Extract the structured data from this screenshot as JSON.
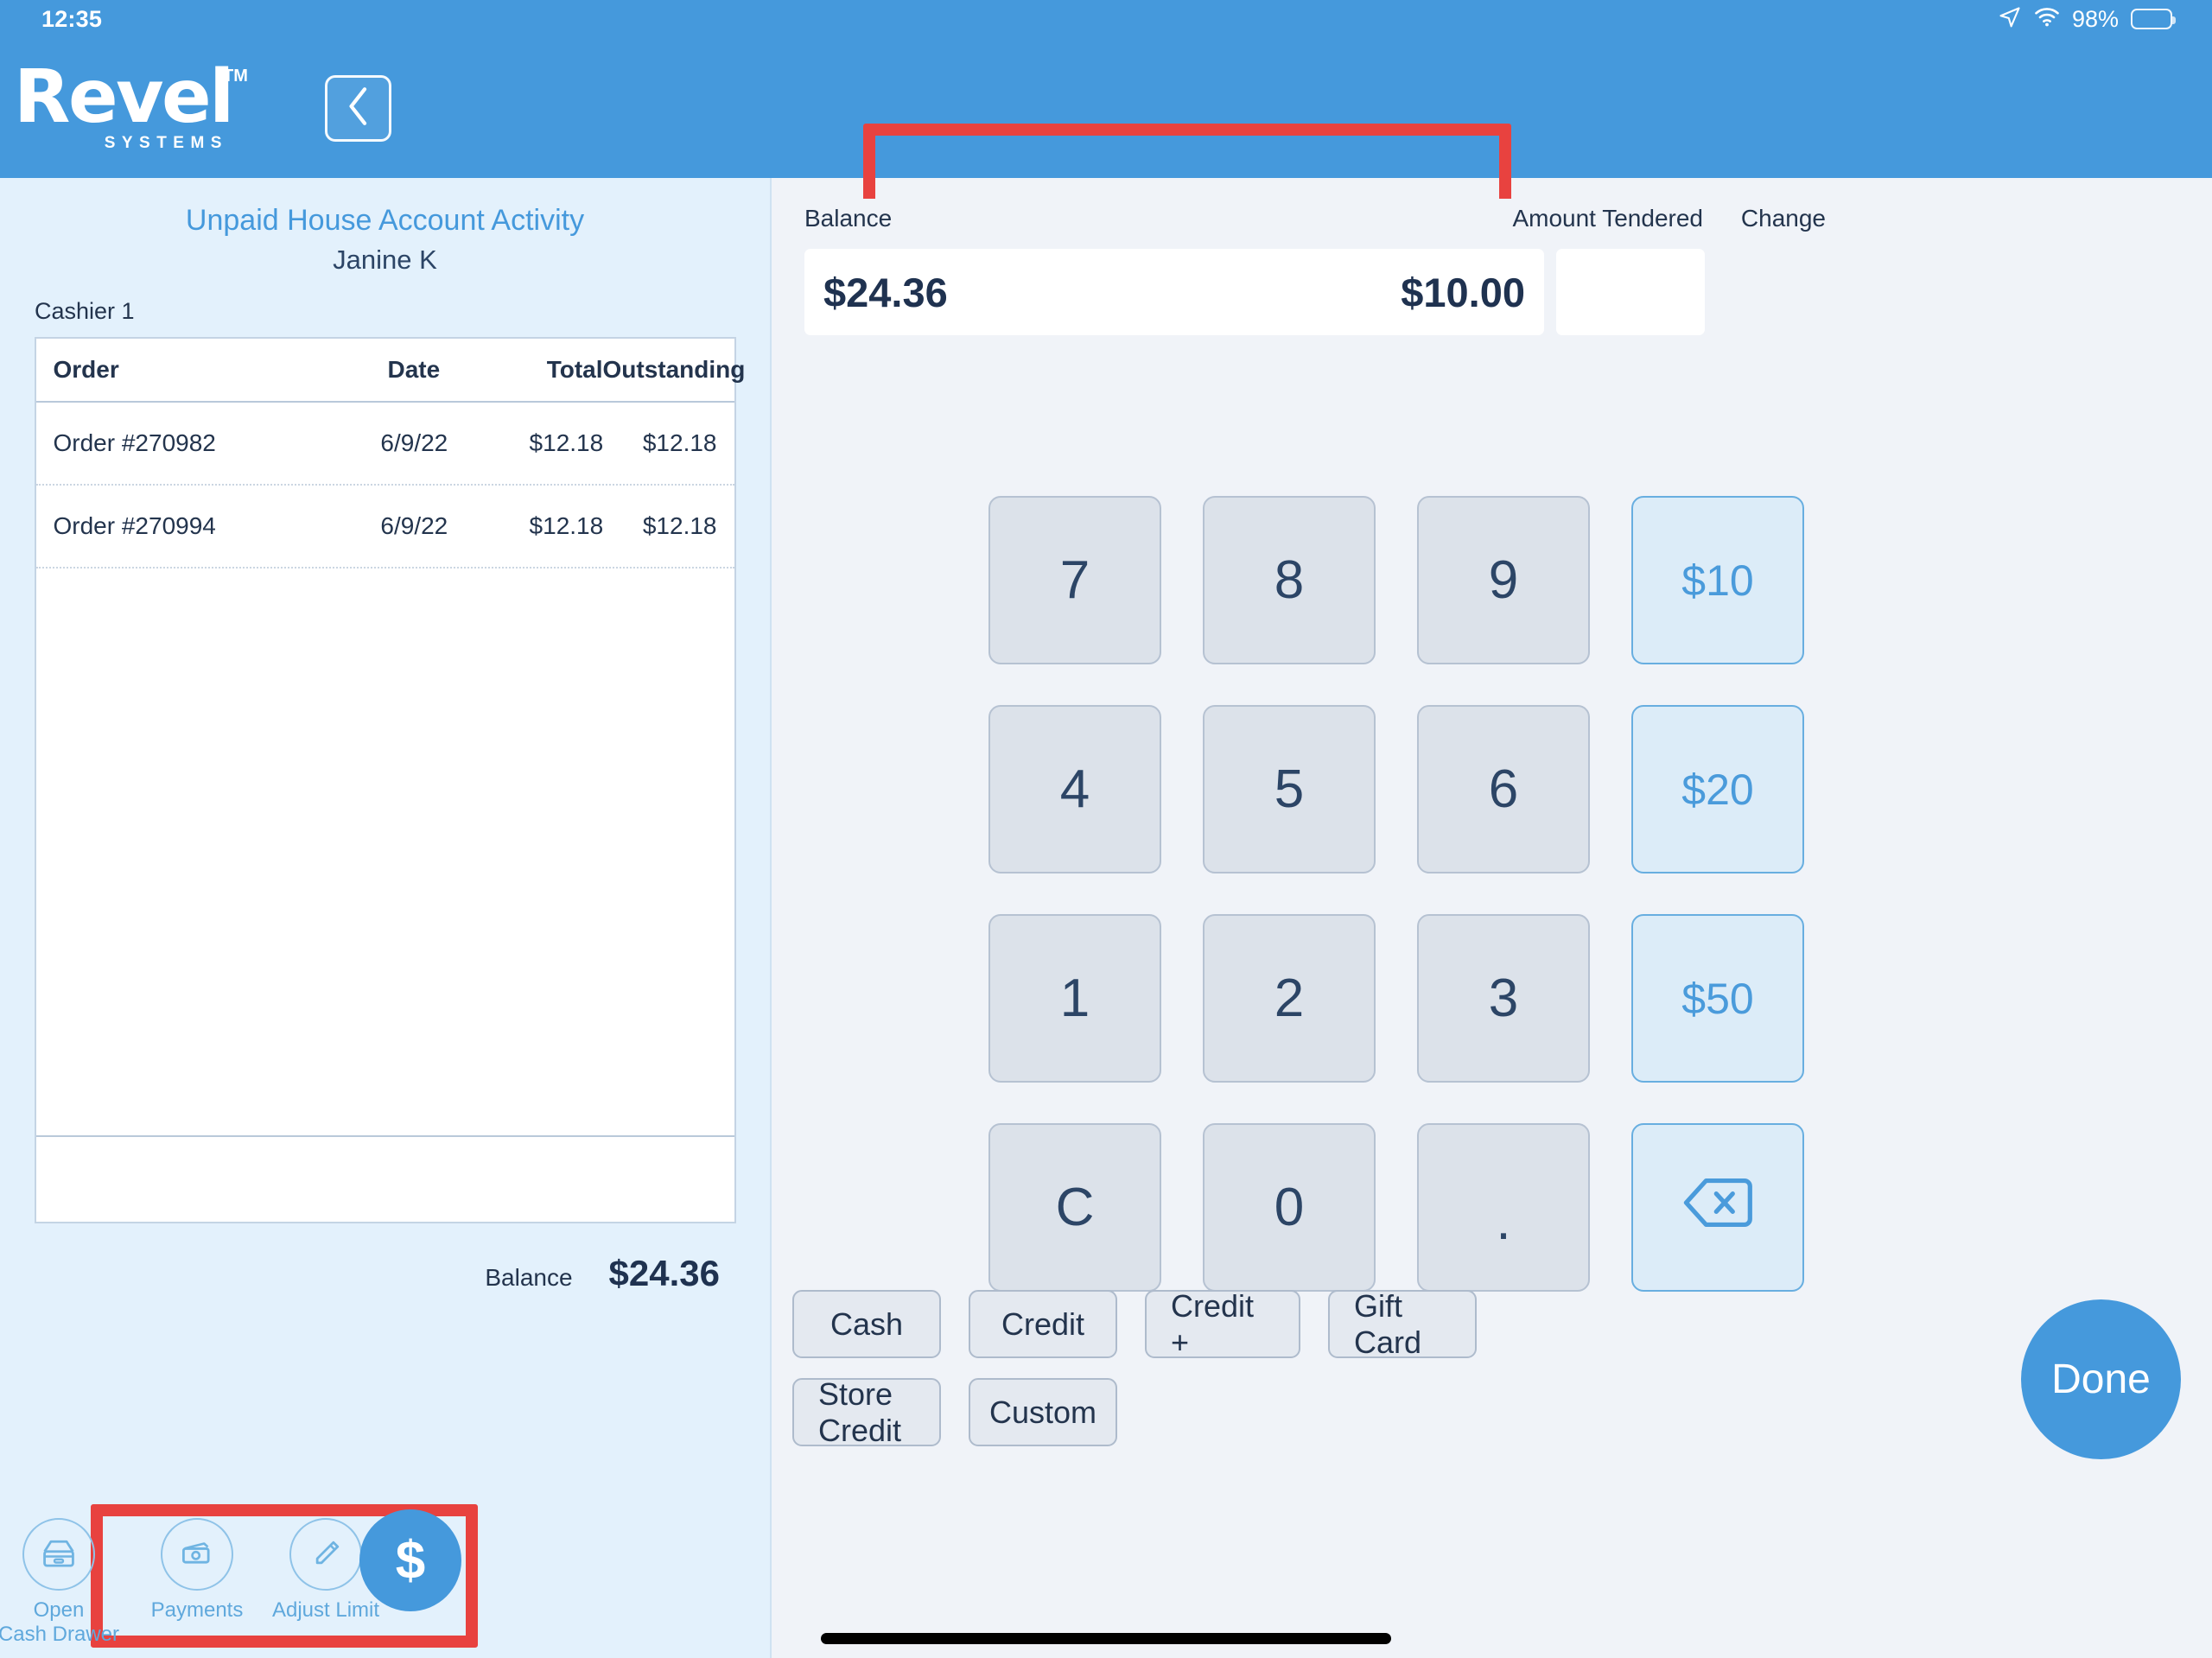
{
  "status_bar": {
    "time": "12:35",
    "battery_percent": "98%",
    "icons": [
      "location-arrow-icon",
      "wifi-icon",
      "battery-icon"
    ]
  },
  "header": {
    "logo_word": "Revel",
    "logo_tm": "TM",
    "logo_subtitle": "SYSTEMS",
    "back_label": "Back"
  },
  "left_panel": {
    "title": "Unpaid House Account Activity",
    "subtitle": "Janine K",
    "cashier": "Cashier 1",
    "table": {
      "columns": [
        "Order",
        "Date",
        "Total",
        "Outstanding"
      ],
      "rows": [
        {
          "order": "Order #270982",
          "date": "6/9/22",
          "total": "$12.18",
          "outstanding": "$12.18"
        },
        {
          "order": "Order #270994",
          "date": "6/9/22",
          "total": "$12.18",
          "outstanding": "$12.18"
        }
      ]
    },
    "balance_label": "Balance",
    "balance_value": "$24.36"
  },
  "toolbar": {
    "open_cash_drawer_line1": "Open",
    "open_cash_drawer_line2": "Cash Drawer",
    "payments_label": "Payments",
    "adjust_limit_label": "Adjust Limit",
    "dollar_fab_label": "$"
  },
  "tender": {
    "balance_label": "Balance",
    "amount_tendered_label": "Amount Tendered",
    "change_label": "Change",
    "balance_value": "$24.36",
    "amount_tendered_value": "$10.00",
    "change_value": ""
  },
  "keypad": {
    "keys": [
      {
        "label": "7",
        "type": "num"
      },
      {
        "label": "8",
        "type": "num"
      },
      {
        "label": "9",
        "type": "num"
      },
      {
        "label": "$10",
        "type": "cash"
      },
      {
        "label": "4",
        "type": "num"
      },
      {
        "label": "5",
        "type": "num"
      },
      {
        "label": "6",
        "type": "num"
      },
      {
        "label": "$20",
        "type": "cash"
      },
      {
        "label": "1",
        "type": "num"
      },
      {
        "label": "2",
        "type": "num"
      },
      {
        "label": "3",
        "type": "num"
      },
      {
        "label": "$50",
        "type": "cash"
      },
      {
        "label": "C",
        "type": "num"
      },
      {
        "label": "0",
        "type": "num"
      },
      {
        "label": ".",
        "type": "dot"
      },
      {
        "label": "",
        "type": "backspace"
      }
    ]
  },
  "payment_types": {
    "row1": [
      "Cash",
      "Credit",
      "Credit +",
      "Gift Card"
    ],
    "row2": [
      "Store Credit",
      "Custom"
    ]
  },
  "done_button": {
    "label": "Done"
  },
  "colors": {
    "header_blue": "#4599DC",
    "left_panel_bg": "#E3F1FC",
    "right_panel_bg": "#F0F3F8",
    "highlight_red": "#E8423F",
    "key_grey": "#DCE2EA",
    "key_cash_blue": "#DCECF8",
    "text_dark": "#23344D"
  }
}
